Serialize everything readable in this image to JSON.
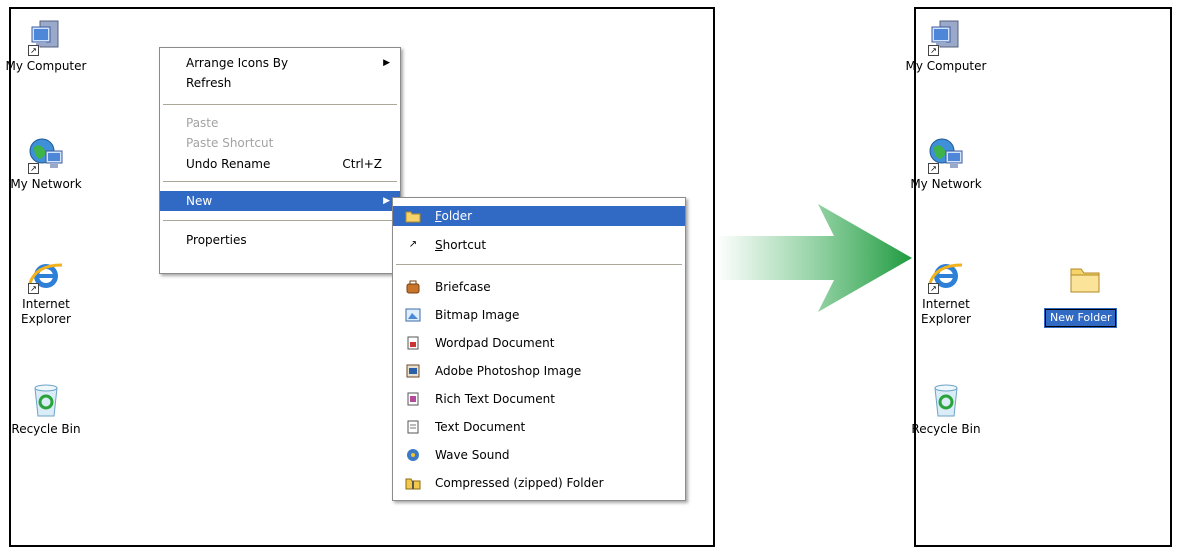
{
  "desktop_left": {
    "icons": [
      {
        "label": "My Computer",
        "icon": "my-computer-icon"
      },
      {
        "label": "My Network",
        "icon": "my-network-icon"
      },
      {
        "label": "Internet\nExplorer",
        "icon": "internet-explorer-icon"
      },
      {
        "label": "Recycle Bin",
        "icon": "recycle-bin-icon"
      }
    ]
  },
  "context_menu": {
    "items": [
      {
        "label": "Arrange Icons By",
        "has_submenu": true
      },
      {
        "label": "Refresh"
      },
      {
        "label": "Paste",
        "disabled": true
      },
      {
        "label": "Paste Shortcut",
        "disabled": true
      },
      {
        "label": "Undo Rename",
        "shortcut": "Ctrl+Z"
      },
      {
        "label": "New",
        "has_submenu": true,
        "highlighted": true
      },
      {
        "label": "Properties"
      }
    ]
  },
  "new_submenu": {
    "items": [
      {
        "label_first": "F",
        "label_rest": "older",
        "icon": "folder-icon",
        "highlighted": true
      },
      {
        "label_first": "S",
        "label_rest": "hortcut",
        "icon": "shortcut-icon"
      },
      {
        "label": "Briefcase",
        "icon": "briefcase-icon"
      },
      {
        "label": "Bitmap Image",
        "icon": "bitmap-image-icon"
      },
      {
        "label": "Wordpad Document",
        "icon": "wordpad-document-icon"
      },
      {
        "label": "Adobe Photoshop Image",
        "icon": "photoshop-image-icon"
      },
      {
        "label": "Rich Text Document",
        "icon": "rich-text-document-icon"
      },
      {
        "label": "Text Document",
        "icon": "text-document-icon"
      },
      {
        "label": "Wave Sound",
        "icon": "wave-sound-icon"
      },
      {
        "label": "Compressed (zipped) Folder",
        "icon": "zipped-folder-icon"
      }
    ]
  },
  "desktop_right": {
    "icons": [
      {
        "label": "My Computer",
        "icon": "my-computer-icon"
      },
      {
        "label": "My Network",
        "icon": "my-network-icon"
      },
      {
        "label": "Internet\nExplorer",
        "icon": "internet-explorer-icon"
      },
      {
        "label": "Recycle Bin",
        "icon": "recycle-bin-icon"
      }
    ],
    "new_folder": {
      "label": "New Folder",
      "icon": "folder-icon"
    }
  },
  "colors": {
    "menu_highlight": "#316ac5",
    "disabled_text": "#a3a3a3",
    "arrow_green": "#2fa84f"
  }
}
